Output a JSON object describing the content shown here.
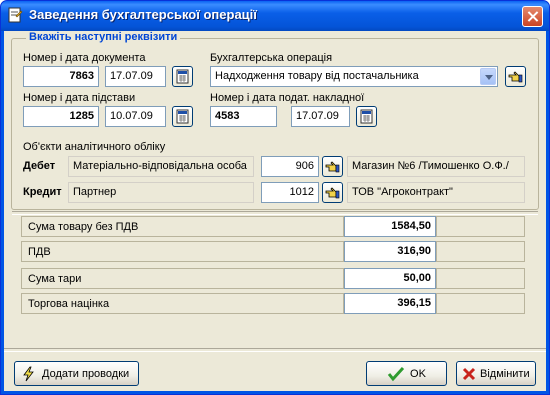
{
  "window": {
    "title": "Заведення бухгалтерської операції"
  },
  "group": {
    "legend": "Вкажіть наступні реквізити"
  },
  "document": {
    "label": "Номер і дата документа",
    "number": "7863",
    "date": "17.07.09"
  },
  "operation": {
    "label": "Бухгалтерська операція",
    "value": "Надходження товару від постачальника"
  },
  "basis": {
    "label": "Номер і дата підстави",
    "number": "1285",
    "date": "10.07.09"
  },
  "tax_invoice": {
    "label": "Номер і дата подат. накладної",
    "number": "4583",
    "date": "17.07.09"
  },
  "analytics": {
    "label": "Об'єкти аналітичного обліку",
    "debit": {
      "label": "Дебет",
      "object": "Матеріально-відповідальна особа",
      "code": "906",
      "name": "Магазин №6 /Тимошенко О.Ф./"
    },
    "credit": {
      "label": "Кредит",
      "object": "Партнер",
      "code": "1012",
      "name": "ТОВ \"Агроконтракт\""
    }
  },
  "summary": [
    {
      "label": "Сума товару без ПДВ",
      "value": "1584,50"
    },
    {
      "label": "ПДВ",
      "value": "316,90"
    },
    {
      "label": "Сума тари",
      "value": "50,00"
    },
    {
      "label": "Торгова націнка",
      "value": "396,15"
    }
  ],
  "buttons": {
    "add_entries": "Додати проводки",
    "ok": "OK",
    "cancel": "Відмінити"
  },
  "colors": {
    "title_bar": "#0454d8",
    "legend": "#0046d5",
    "face": "#ece9d8",
    "ok_check": "#2f9b2f",
    "cancel_x": "#c8241c"
  },
  "icons": [
    "document-icon",
    "calendar-icon",
    "pointing-hand-icon",
    "lightning-icon",
    "checkmark-icon",
    "x-icon",
    "close-icon"
  ]
}
